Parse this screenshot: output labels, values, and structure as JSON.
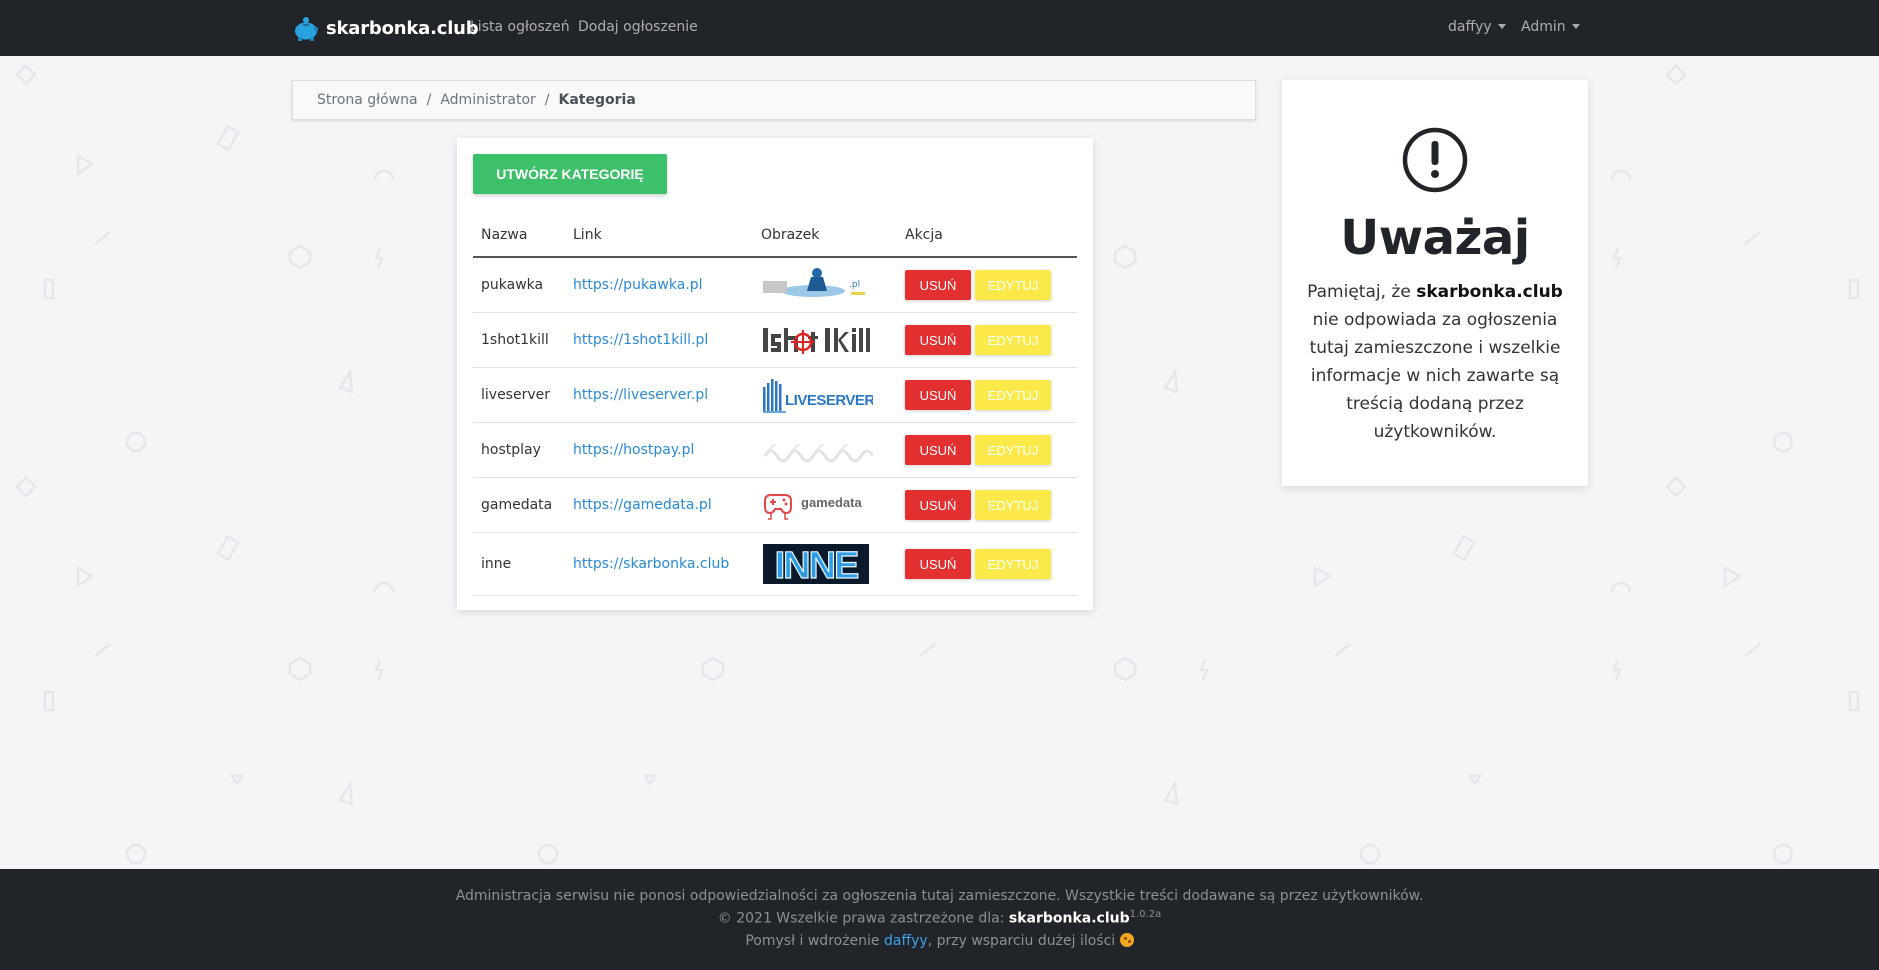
{
  "nav": {
    "brand": "skarbonka.club",
    "links": [
      "Lista ogłoszeń",
      "Dodaj ogłoszenie"
    ],
    "user": "daffyy",
    "admin": "Admin"
  },
  "breadcrumb": {
    "home": "Strona główna",
    "admin": "Administrator",
    "current": "Kategoria"
  },
  "main": {
    "create_label": "UTWÓRZ KATEGORIĘ",
    "columns": [
      "Nazwa",
      "Link",
      "Obrazek",
      "Akcja"
    ],
    "delete_label": "USUŃ",
    "edit_label": "EDYTUJ",
    "rows": [
      {
        "name": "pukawka",
        "link": "https://pukawka.pl",
        "logo": "pukawka-logo"
      },
      {
        "name": "1shot1kill",
        "link": "https://1shot1kill.pl",
        "logo": "1shot1kill-logo"
      },
      {
        "name": "liveserver",
        "link": "https://liveserver.pl",
        "logo": "liveserver-logo"
      },
      {
        "name": "hostplay",
        "link": "https://hostpay.pl",
        "logo": "hostplay-logo"
      },
      {
        "name": "gamedata",
        "link": "https://gamedata.pl",
        "logo": "gamedata-logo"
      },
      {
        "name": "inne",
        "link": "https://skarbonka.club",
        "logo": "inne-logo"
      }
    ]
  },
  "side": {
    "icon": "exclamation-circle-icon",
    "title": "Uważaj",
    "text_before": "Pamiętaj, że ",
    "text_brand": "skarbonka.club",
    "text_after": " nie odpowiada za ogłoszenia tutaj zamieszczone i wszelkie informacje w nich zawarte są treścią dodaną przez użytkowników."
  },
  "footer": {
    "line1": "Administracja serwisu nie ponosi odpowiedzialności za ogłoszenia tutaj zamieszczone. Wszystkie treści dodawane są przez użytkowników.",
    "line2_prefix": "© 2021 Wszelkie prawa zastrzeżone dla: ",
    "line2_brand": "skarbonka.club",
    "version": "1.0.2a",
    "line3_prefix": "Pomysł i wdrożenie ",
    "author": "daffyy",
    "line3_suffix": ", przy wsparciu dużej ilości "
  },
  "colors": {
    "navbar": "#212529",
    "create": "#3cc06a",
    "delete": "#e32f2f",
    "edit": "#fbe94a",
    "link": "#2a8ad4"
  }
}
